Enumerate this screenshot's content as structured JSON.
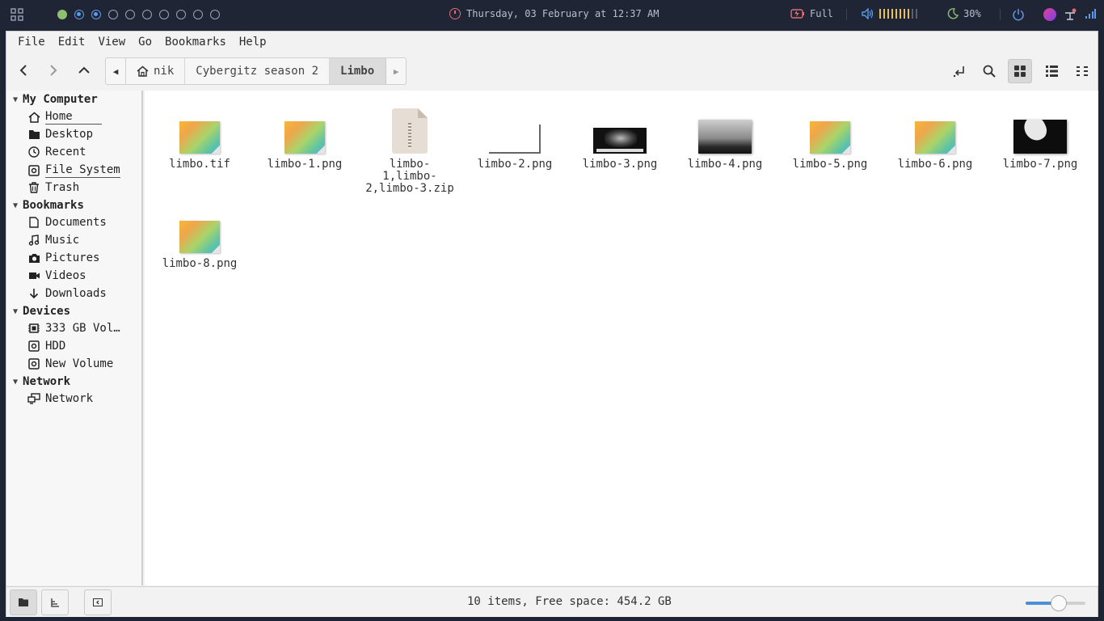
{
  "panel": {
    "clock": "Thursday, 03 February at 12:37 AM",
    "battery": "Full",
    "brightness": "30%",
    "workspaces": 10
  },
  "menubar": [
    "File",
    "Edit",
    "View",
    "Go",
    "Bookmarks",
    "Help"
  ],
  "breadcrumbs": {
    "home": "nik",
    "parent": "Cybergitz season 2",
    "current": "Limbo"
  },
  "sidebar": {
    "sections": {
      "my_computer": "My Computer",
      "bookmarks": "Bookmarks",
      "devices": "Devices",
      "network": "Network"
    },
    "my_computer": [
      "Home",
      "Desktop",
      "Recent",
      "File System",
      "Trash"
    ],
    "bookmarks": [
      "Documents",
      "Music",
      "Pictures",
      "Videos",
      "Downloads"
    ],
    "devices": [
      "333 GB Vol…",
      "HDD",
      "New Volume"
    ],
    "network": [
      "Network"
    ]
  },
  "files": [
    {
      "name": "limbo.tif",
      "kind": "gradient"
    },
    {
      "name": "limbo-1.png",
      "kind": "gradient"
    },
    {
      "name": "limbo-1,limbo-2,limbo-3.zip",
      "line1": "limbo-",
      "line2": "1,limbo-",
      "line3": "2,limbo-3.zip",
      "kind": "zip"
    },
    {
      "name": "limbo-2.png",
      "kind": "blank"
    },
    {
      "name": "limbo-3.png",
      "kind": "dark"
    },
    {
      "name": "limbo-4.png",
      "kind": "gray"
    },
    {
      "name": "limbo-5.png",
      "kind": "gradient"
    },
    {
      "name": "limbo-6.png",
      "kind": "gradient"
    },
    {
      "name": "limbo-7.png",
      "kind": "black"
    },
    {
      "name": "limbo-8.png",
      "kind": "gradient"
    }
  ],
  "status": {
    "text": "10 items, Free space: 454.2 GB",
    "zoom_level": 0.55
  }
}
